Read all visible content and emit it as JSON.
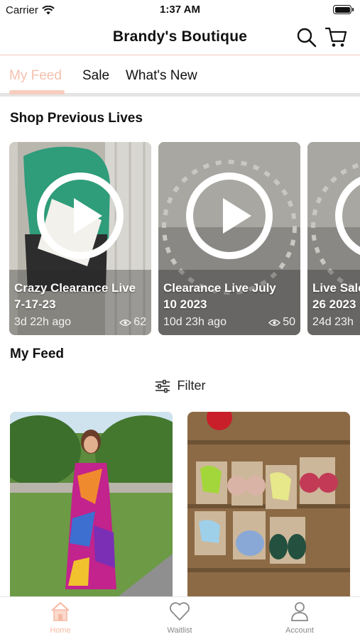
{
  "status_bar": {
    "carrier": "Carrier",
    "time": "1:37 AM"
  },
  "header": {
    "title": "Brandy's Boutique"
  },
  "tabs": [
    {
      "label": "My Feed",
      "active": true
    },
    {
      "label": "Sale",
      "active": false
    },
    {
      "label": "What's New",
      "active": false
    }
  ],
  "sections": {
    "previous_lives": "Shop Previous Lives",
    "my_feed": "My Feed"
  },
  "lives": [
    {
      "title_line1": "Crazy Clearance Live",
      "title_line2": "7-17-23",
      "ago": "3d 22h ago",
      "views": "62"
    },
    {
      "title_line1": "Clearance Live July",
      "title_line2": "10 2023",
      "ago": "10d 23h ago",
      "views": "50"
    },
    {
      "title_line1": "Live Sale",
      "title_line2": "26 2023",
      "ago": "24d 23h",
      "views": ""
    }
  ],
  "filter": {
    "label": "Filter"
  },
  "bottom_nav": [
    {
      "label": "Home",
      "active": true
    },
    {
      "label": "Waitlist",
      "active": false
    },
    {
      "label": "Account",
      "active": false
    }
  ],
  "colors": {
    "accent": "#f4c1ae",
    "header_border": "#f1c9bd",
    "inactive_nav": "#888888"
  }
}
